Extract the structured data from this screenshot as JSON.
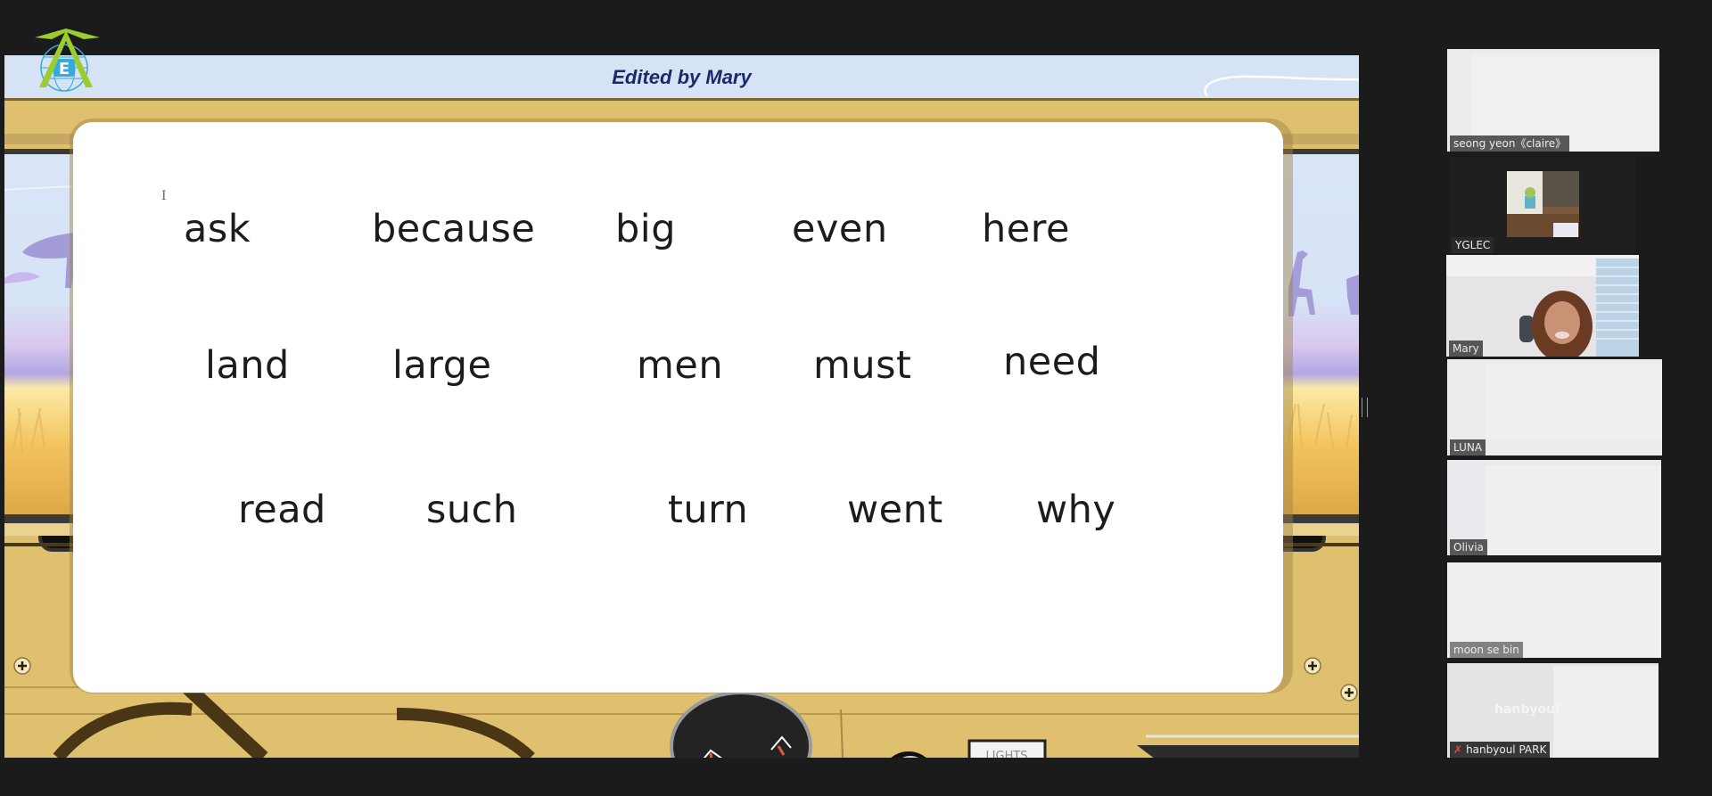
{
  "slide": {
    "header_title": "Edited by Mary",
    "logo_letter": "E",
    "cursor_glyph": "I",
    "dash_label": "LIGHTS",
    "words": [
      [
        "ask",
        "because",
        "big",
        "even",
        "here"
      ],
      [
        "land",
        "large",
        "men",
        "must",
        "need"
      ],
      [
        "read",
        "such",
        "turn",
        "went",
        "why"
      ]
    ]
  },
  "gallery": {
    "participants": [
      {
        "name": "seong yeon《claire》",
        "video": "blurred",
        "active": false
      },
      {
        "name": "YGLEC",
        "video": "profile-photo",
        "active": false
      },
      {
        "name": "Mary",
        "video": "camera",
        "active": true
      },
      {
        "name": "LUNA",
        "video": "blurred",
        "active": false
      },
      {
        "name": "Olivia",
        "video": "blurred",
        "active": false
      },
      {
        "name": "moon se bin",
        "video": "blurred",
        "active": false
      },
      {
        "name": "hanbyoul PARK",
        "video": "avatar",
        "watermark": "hanbyoul",
        "muted": true,
        "active": false
      }
    ]
  },
  "colors": {
    "active_speaker": "#c6e85a",
    "header_text": "#1a2a6a",
    "muted": "#e04848"
  }
}
